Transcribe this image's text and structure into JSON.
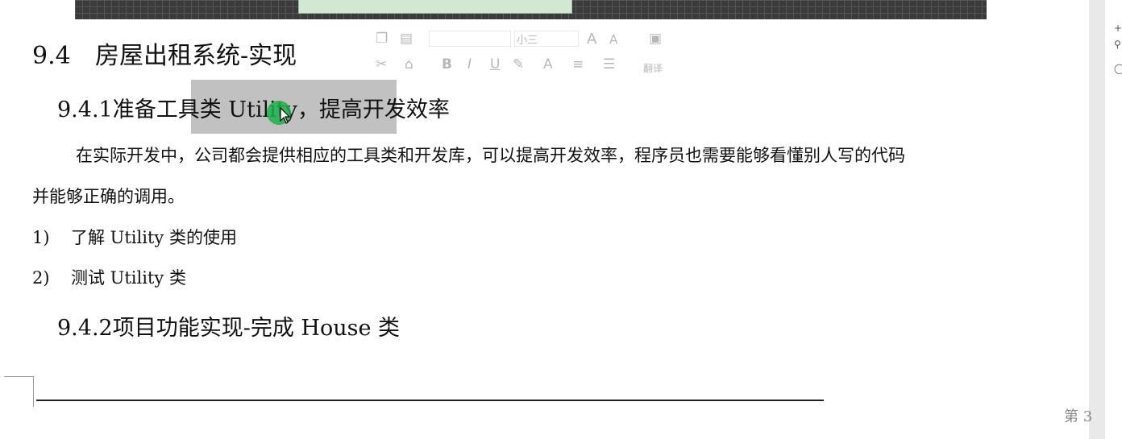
{
  "doc": {
    "h2_num": "9.4",
    "h2_text": "房屋出租系统-实现",
    "h3a": "9.4.1准备工具类 Utility，提高开发效率",
    "para1": "在实际开发中，公司都会提供相应的工具类和开发库，可以提高开发效率，程序员也需要能够看懂别人写的代码",
    "para2": "并能够正确的调用。",
    "list1_num": "1)",
    "list1_text": "了解 Utility 类的使用",
    "list2_num": "2)",
    "list2_text": "测试 Utility 类",
    "h3b": "9.4.2项目功能实现-完成 House 类",
    "page_label": "第 3"
  },
  "toolbar": {
    "size_value": "小三",
    "bold": "B",
    "italic": "I",
    "underline": "U",
    "grow_font": "A",
    "shrink_font": "A",
    "translate": "翻译"
  },
  "colors": {
    "selection": "#a0a0a0",
    "cursor_dot": "#19b34a",
    "strip": "#3b3b3b"
  }
}
